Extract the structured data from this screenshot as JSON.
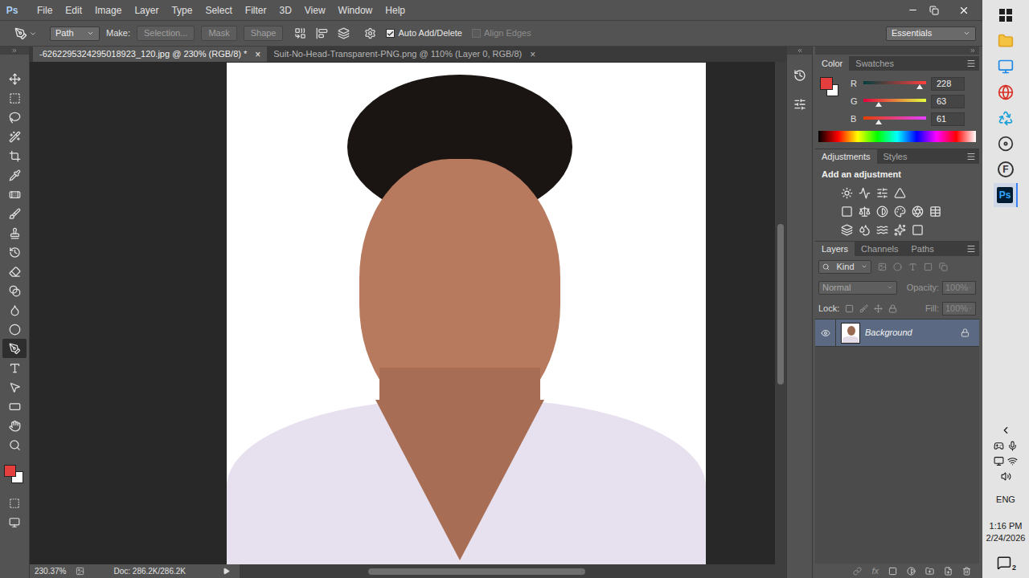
{
  "app": {
    "logo": "Ps"
  },
  "menu": [
    "File",
    "Edit",
    "Image",
    "Layer",
    "Type",
    "Select",
    "Filter",
    "3D",
    "View",
    "Window",
    "Help"
  ],
  "options_bar": {
    "mode": "Path",
    "make_label": "Make:",
    "buttons": [
      "Selection...",
      "Mask",
      "Shape"
    ],
    "checkboxes": [
      {
        "label": "Auto Add/Delete",
        "checked": true,
        "disabled": false
      },
      {
        "label": "Align Edges",
        "checked": false,
        "disabled": true
      }
    ],
    "workspace": "Essentials"
  },
  "doc_tabs": [
    {
      "label": "-6262295324295018923_120.jpg @ 230% (RGB/8) *",
      "close": "×",
      "selected": true
    },
    {
      "label": "Suit-No-Head-Transparent-PNG.png @ 110% (Layer 0, RGB/8)",
      "close": "×",
      "selected": false
    }
  ],
  "tools": [
    {
      "kind": "move",
      "selected": false
    },
    {
      "kind": "marquee",
      "selected": false
    },
    {
      "kind": "lasso",
      "selected": false
    },
    {
      "kind": "quick-select",
      "selected": false
    },
    {
      "kind": "crop",
      "selected": false
    },
    {
      "kind": "eyedropper",
      "selected": false
    },
    {
      "kind": "healing",
      "selected": false
    },
    {
      "kind": "brush",
      "selected": false
    },
    {
      "kind": "stamp",
      "selected": false
    },
    {
      "kind": "history-brush",
      "selected": false
    },
    {
      "kind": "eraser",
      "selected": false
    },
    {
      "kind": "gradient",
      "selected": false
    },
    {
      "kind": "blur",
      "selected": false
    },
    {
      "kind": "dodge",
      "selected": false
    },
    {
      "kind": "pen",
      "selected": true
    },
    {
      "kind": "type",
      "selected": false
    },
    {
      "kind": "path-select",
      "selected": false
    },
    {
      "kind": "shape",
      "selected": false
    },
    {
      "kind": "hand",
      "selected": false
    },
    {
      "kind": "zoom",
      "selected": false
    }
  ],
  "swatches": {
    "foreground": "#e43f3d",
    "background": "#ffffff"
  },
  "status_bar": {
    "zoom": "230.37%",
    "doc": "Doc: 286.2K/286.2K"
  },
  "color_panel": {
    "tabs": [
      {
        "label": "Color",
        "selected": true
      },
      {
        "label": "Swatches",
        "selected": false
      }
    ],
    "foreground": "#e43f3d",
    "background": "#ffffff",
    "channels": [
      {
        "name": "R",
        "value": "228",
        "level": 0.894
      },
      {
        "name": "G",
        "value": "63",
        "level": 0.247
      },
      {
        "name": "B",
        "value": "61",
        "level": 0.239
      }
    ]
  },
  "adjustments_panel": {
    "tabs": [
      {
        "label": "Adjustments",
        "selected": true
      },
      {
        "label": "Styles",
        "selected": false
      }
    ],
    "title": "Add an adjustment"
  },
  "layers_panel": {
    "tabs": [
      {
        "label": "Layers",
        "selected": true
      },
      {
        "label": "Channels",
        "selected": false
      },
      {
        "label": "Paths",
        "selected": false
      }
    ],
    "filter": "Kind",
    "blend_mode": "Normal",
    "opacity_label": "Opacity:",
    "opacity": "100%",
    "lock_label": "Lock:",
    "fill_label": "Fill:",
    "fill": "100%",
    "fields_disabled": true,
    "layers": [
      {
        "name": "Background",
        "visible": true,
        "locked": true,
        "selected": true
      }
    ],
    "fx": "fx"
  },
  "taskbar": {
    "apps": [
      {
        "kind": "start",
        "label": "",
        "selected": false
      },
      {
        "kind": "explorer",
        "label": "",
        "selected": false
      },
      {
        "kind": "monitor",
        "label": "",
        "selected": false
      },
      {
        "kind": "chrome",
        "label": "",
        "selected": false
      },
      {
        "kind": "recycle",
        "label": "",
        "selected": false
      },
      {
        "kind": "recorder",
        "label": "",
        "selected": false
      },
      {
        "kind": "f-app",
        "label": "F",
        "selected": false
      },
      {
        "kind": "photoshop",
        "label": "Ps",
        "selected": true
      }
    ],
    "language": "ENG",
    "time": "1:16 PM",
    "date": "2/24/2026",
    "notifications": "2"
  }
}
